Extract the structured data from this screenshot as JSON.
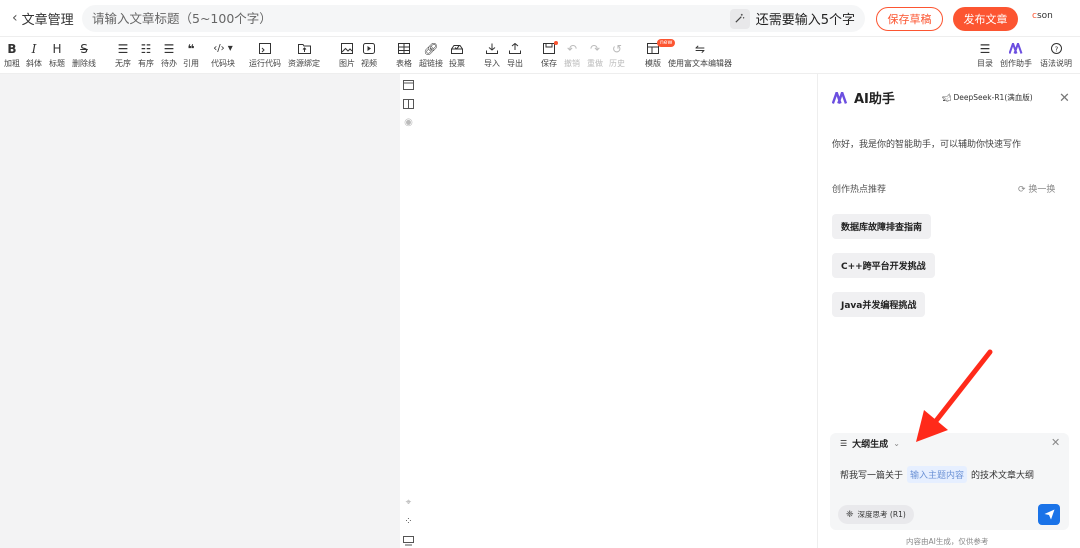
{
  "header": {
    "back_label": "文章管理",
    "title_placeholder": "请输入文章标题（5~100个字）",
    "title_value": "",
    "remaining": "还需要输入5个字",
    "save_draft": "保存草稿",
    "publish": "发布文章",
    "logo": "csdn"
  },
  "toolbar": {
    "bold": "加粗",
    "italic": "斜体",
    "heading": "标题",
    "strike": "删除线",
    "unordered": "无序",
    "ordered": "有序",
    "todo": "待办",
    "quote": "引用",
    "code_block": "代码块",
    "run_code": "运行代码",
    "resource": "资源绑定",
    "image": "图片",
    "video": "视频",
    "table": "表格",
    "link": "超链接",
    "vote": "投票",
    "import": "导入",
    "export": "导出",
    "save": "保存",
    "undo": "撤销",
    "redo": "重做",
    "history": "历史",
    "template": "模版",
    "template_badge": "new",
    "rich_editor": "使用富文本编辑器",
    "toc": "目录",
    "assistant": "创作助手",
    "syntax": "语法说明"
  },
  "ai_panel": {
    "title": "AI助手",
    "model": "DeepSeek-R1(满血版)",
    "greeting": "你好，我是你的智能助手，可以辅助你快速写作",
    "hot_title": "创作热点推荐",
    "refresh": "换一换",
    "chips": [
      "数据库故障排查指南",
      "C++跨平台开发挑战",
      "Java并发编程挑战"
    ],
    "composer": {
      "mode": "大纲生成",
      "prefix": "帮我写一篇关于",
      "placeholder": "输入主题内容",
      "suffix": "的技术文章大纲",
      "deep_think": "深度思考 (R1)"
    },
    "footer": "内容由AI生成，仅供参考"
  },
  "colors": {
    "brand": "#fc5531",
    "send": "#1a73e8",
    "arrow": "#ff2a1a"
  }
}
